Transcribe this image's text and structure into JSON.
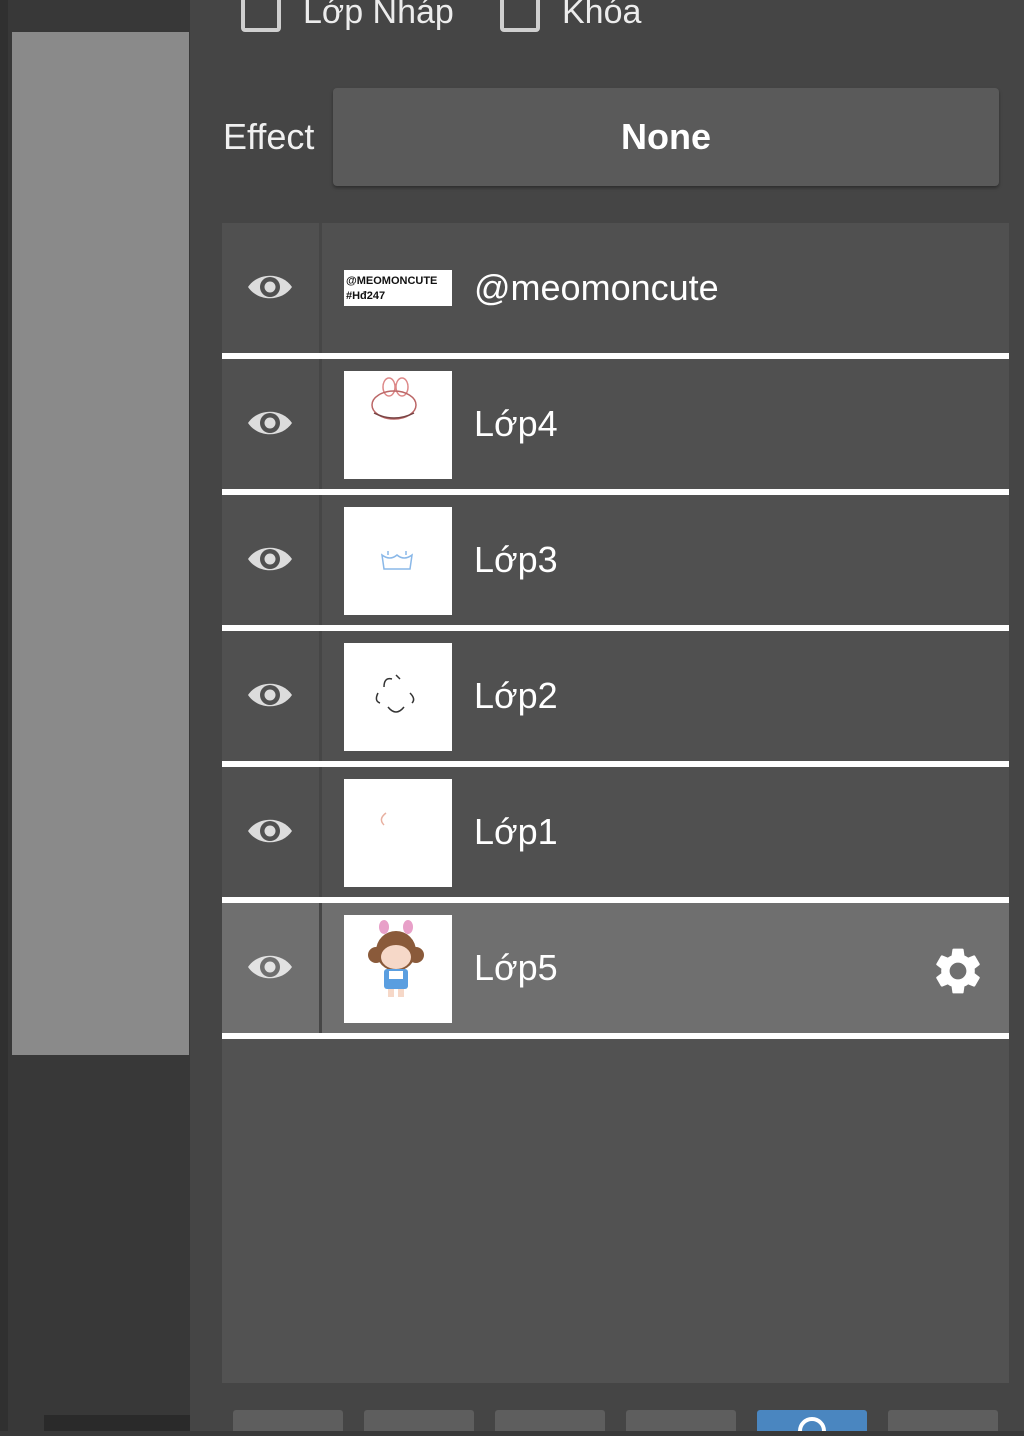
{
  "options": {
    "draft_label": "Lớp Nháp",
    "lock_label": "Khóa"
  },
  "effect": {
    "label": "Effect",
    "value": "None"
  },
  "layers": [
    {
      "name": "@meomoncute",
      "thumbnail_text": [
        "@MEOMONCUTE",
        "#Hđ247"
      ],
      "visible": true,
      "selected": false
    },
    {
      "name": "Lớp4",
      "visible": true,
      "selected": false
    },
    {
      "name": "Lớp3",
      "visible": true,
      "selected": false
    },
    {
      "name": "Lớp2",
      "visible": true,
      "selected": false
    },
    {
      "name": "Lớp1",
      "visible": true,
      "selected": false
    },
    {
      "name": "Lớp5",
      "visible": true,
      "selected": true
    }
  ],
  "icons": {
    "visibility": "eye-icon",
    "settings": "gear-icon"
  },
  "colors": {
    "panel": "#454545",
    "row": "#505050",
    "selected_row": "#6f6f6f",
    "active_tool": "#4a86c0"
  }
}
